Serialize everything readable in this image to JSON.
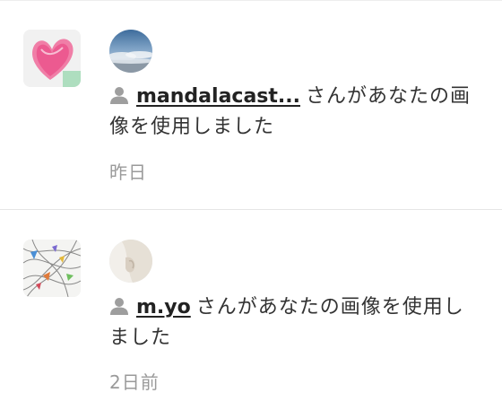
{
  "notifications": [
    {
      "username": "mandalacast...",
      "message": "さんがあなたの画像を使用しました",
      "time": "昨日",
      "thumbnail_icon": "pink-heart-drawing",
      "avatar_icon": "sky-clouds-photo"
    },
    {
      "username": "m.yo",
      "message": "さんがあなたの画像を使用しました",
      "time": "2日前",
      "thumbnail_icon": "abstract-colorful-lines",
      "avatar_icon": "white-cloth-photo"
    }
  ],
  "colors": {
    "text": "#333333",
    "muted": "#9a9a9a",
    "divider": "#e6e6e6",
    "user_icon": "#9e9e9e"
  }
}
